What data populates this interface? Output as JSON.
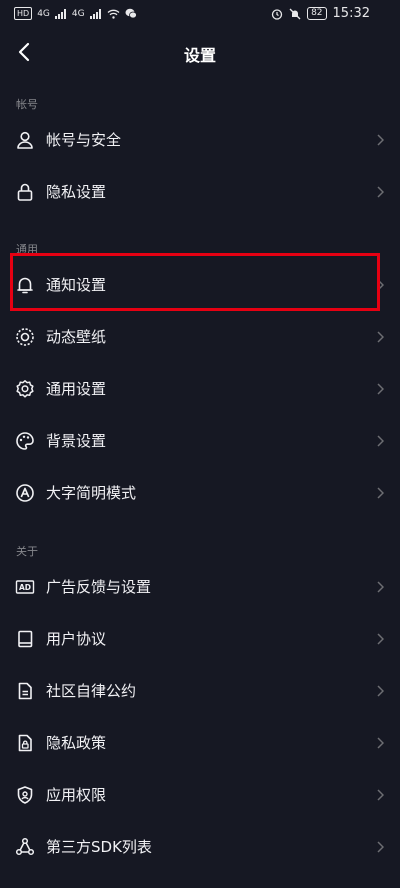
{
  "status_bar": {
    "hd_label": "HD",
    "net_left": "4G",
    "net_right": "4G",
    "battery": "82",
    "time": "15:32"
  },
  "header": {
    "title": "设置"
  },
  "sections": {
    "account": "帐号",
    "general": "通用",
    "about": "关于"
  },
  "rows": {
    "account_security": "帐号与安全",
    "privacy_settings": "隐私设置",
    "notification_settings": "通知设置",
    "live_wallpaper": "动态壁纸",
    "general_settings": "通用设置",
    "background_settings": "背景设置",
    "large_font_mode": "大字简明模式",
    "ad_feedback": "广告反馈与设置",
    "user_agreement": "用户协议",
    "community_rules": "社区自律公约",
    "privacy_policy": "隐私政策",
    "app_permissions": "应用权限",
    "third_party_sdk": "第三方SDK列表"
  },
  "icons": {
    "ad_badge": "AD"
  },
  "colors": {
    "background": "#161823",
    "text": "#f1f1f4",
    "section_text": "#86878c",
    "chevron": "#6d6e73",
    "highlight": "#e60012"
  }
}
